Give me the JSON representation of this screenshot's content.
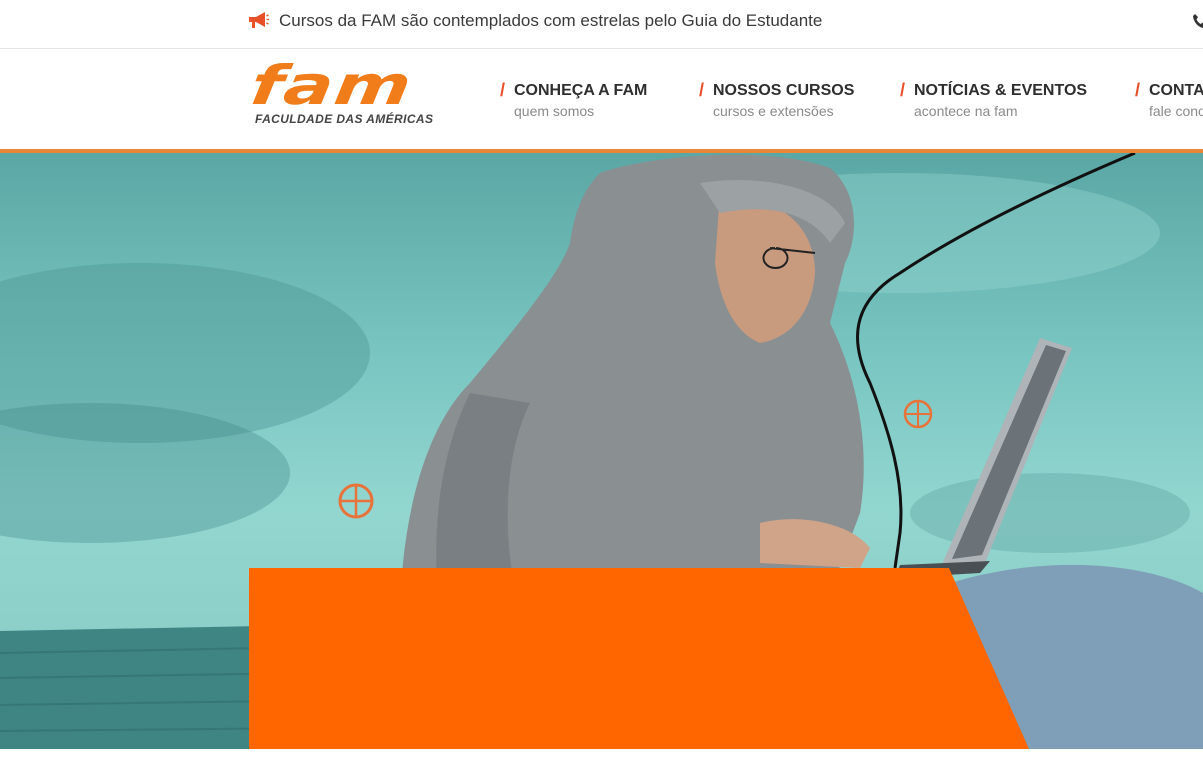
{
  "topbar": {
    "announcement": "Cursos da FAM são contemplados com estrelas pelo Guia do Estudante",
    "announcement_icon": "megaphone-icon",
    "phone_icon": "phone-icon"
  },
  "logo": {
    "wordmark": "fam",
    "subtitle": "FACULDADE DAS AMÉRICAS"
  },
  "nav": [
    {
      "title": "CONHEÇA A FAM",
      "subtitle": "quem somos"
    },
    {
      "title": "NOSSOS CURSOS",
      "subtitle": "cursos e extensões"
    },
    {
      "title": "NOTÍCIAS & EVENTOS",
      "subtitle": "acontece na fam"
    },
    {
      "title": "CONTATO",
      "subtitle": "fale conosco"
    }
  ],
  "colors": {
    "brand_orange": "#f07d1a",
    "accent_red": "#e8502a",
    "panel_orange": "#ff6600",
    "hero_teal": "#7ac6c2"
  }
}
